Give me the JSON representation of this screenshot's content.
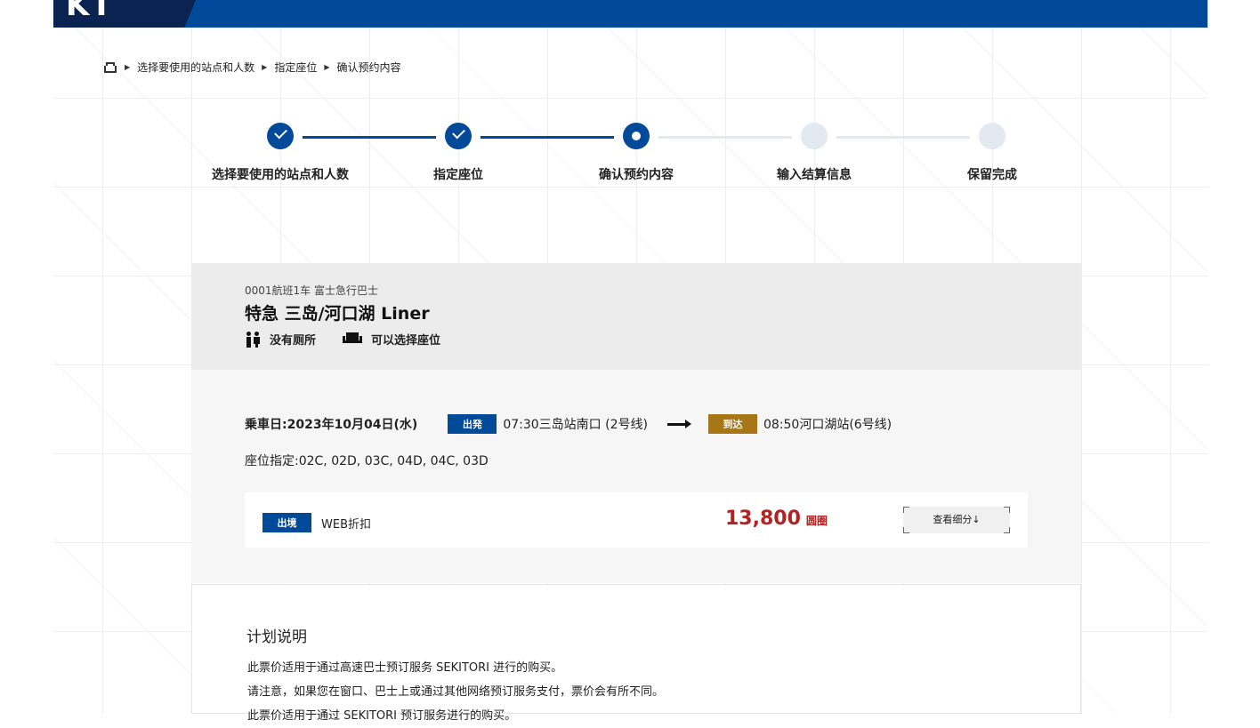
{
  "header": {
    "logo_text": "KT"
  },
  "breadcrumb": {
    "home_icon": "home-icon",
    "items": [
      "选择要使用的站点和人数",
      "指定座位",
      "确认预约内容"
    ]
  },
  "steps": [
    {
      "label": "选择要使用的站点和人数",
      "status": "done"
    },
    {
      "label": "指定座位",
      "status": "done"
    },
    {
      "label": "确认预约内容",
      "status": "current"
    },
    {
      "label": "输入结算信息",
      "status": "todo"
    },
    {
      "label": "保留完成",
      "status": "todo"
    }
  ],
  "bus": {
    "flight_no": "0001航班1车 富士急行巴士",
    "route_name": "特急 三岛/河口湖 Liner",
    "amenities": {
      "restroom": "没有厕所",
      "seat": "可以选择座位"
    }
  },
  "trip": {
    "date": "乗車日:2023年10月04日(水)",
    "depart_badge": "出発",
    "depart": "07:30三岛站南口 (2号线)",
    "arrive_badge": "到达",
    "arrive": "08:50河口湖站(6号线)",
    "seats": "座位指定:02C, 02D, 03C, 04D, 04C, 03D"
  },
  "fare": {
    "badge": "出境",
    "type": "WEB折扣",
    "amount": "13,800",
    "currency": "圆圈",
    "detail_button": "查看细分↓"
  },
  "plan": {
    "title": "计划说明",
    "lines": [
      "此票价适用于通过高速巴士预订服务 SEKITORI 进行的购买。",
      "请注意，如果您在窗口、巴士上或通过其他网络预订服务支付，票价会有所不同。",
      "此票价适用于通过 SEKITORI 预订服务进行的购买。"
    ]
  },
  "colors": {
    "primary": "#004a99",
    "navy": "#0a2350",
    "gold": "#a67617",
    "price": "#b22222"
  }
}
